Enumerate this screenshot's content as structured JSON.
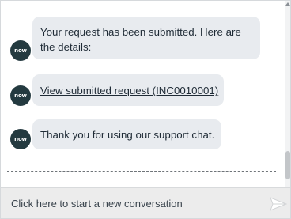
{
  "chat": {
    "avatar_label": "now",
    "messages": [
      {
        "line1": "Your request has been submitted. Here are",
        "line2": "the details:"
      },
      {
        "link_text": "View submitted request (INC0010001)"
      },
      {
        "text": "Thank you for using our support chat."
      }
    ]
  },
  "composer": {
    "placeholder": "Click here to start a new conversation"
  },
  "icons": {
    "avatar": "servicenow-logo-icon",
    "send": "send-icon"
  },
  "colors": {
    "bubble": "#e8ebef",
    "avatar": "#243a40",
    "input_bar": "#ececec"
  }
}
